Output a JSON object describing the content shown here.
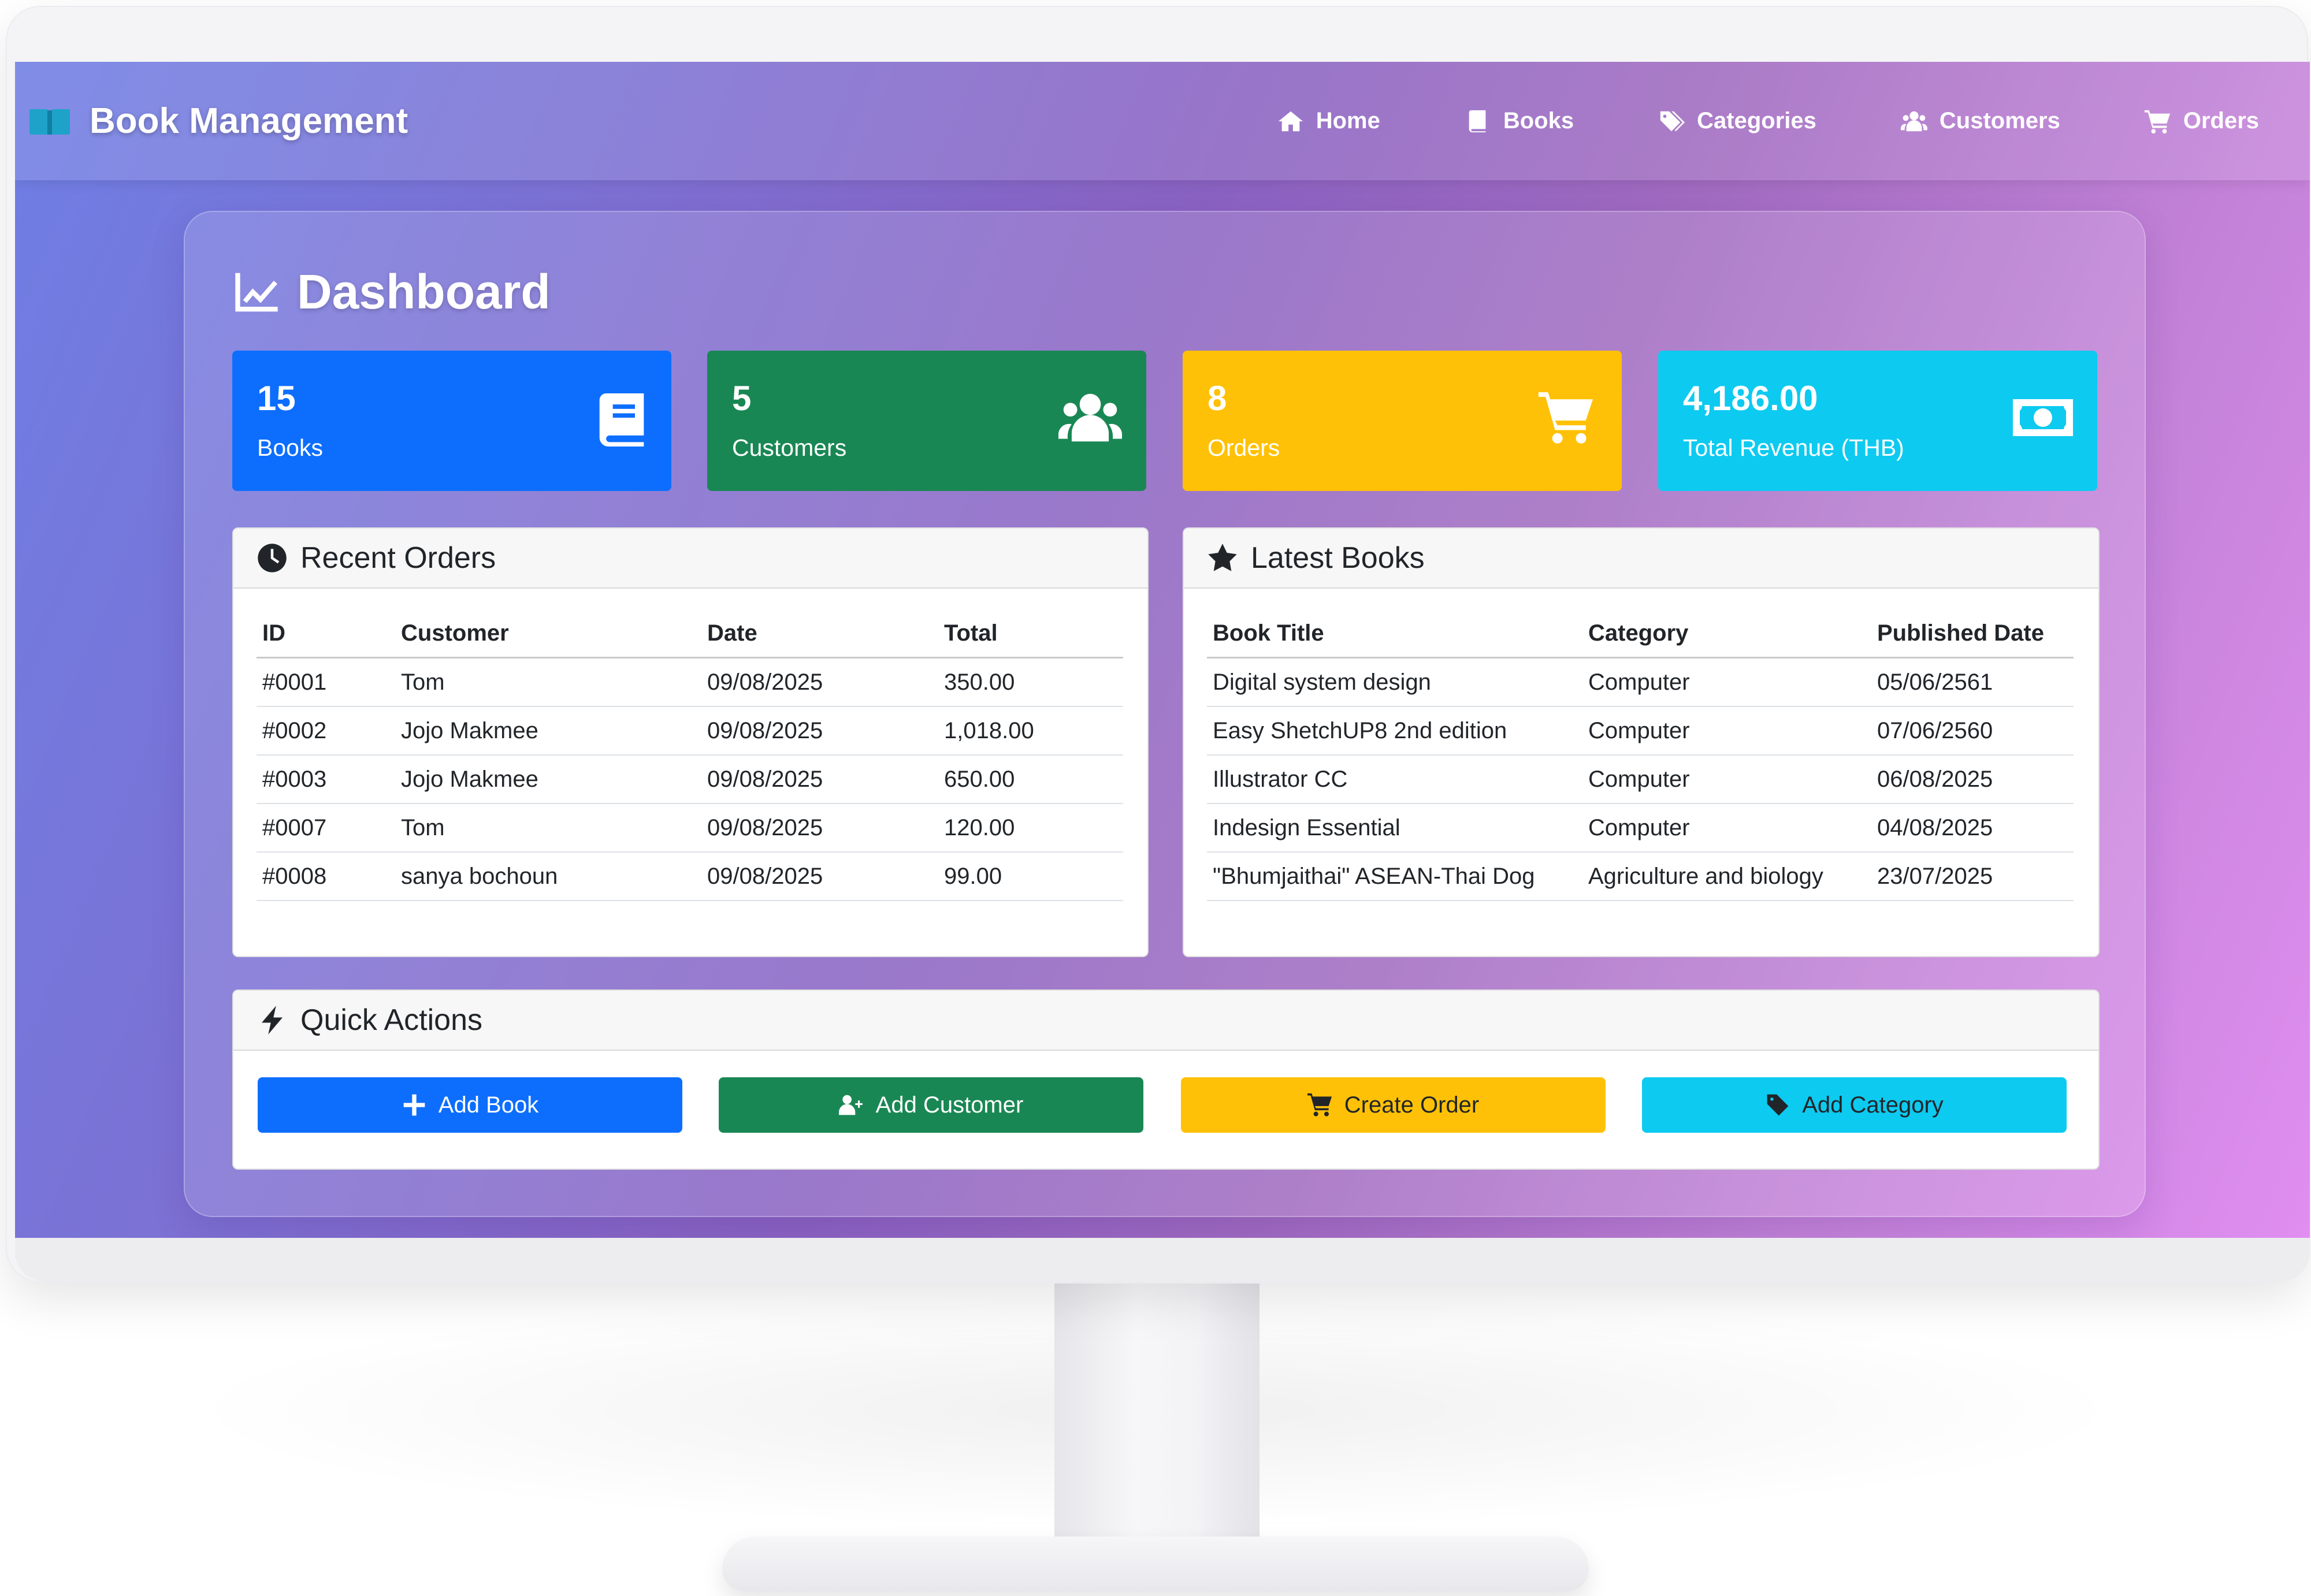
{
  "navbar": {
    "brand": "Book Management",
    "links": [
      {
        "label": "Home",
        "icon": "home-icon"
      },
      {
        "label": "Books",
        "icon": "book-icon"
      },
      {
        "label": "Categories",
        "icon": "tags-icon"
      },
      {
        "label": "Customers",
        "icon": "users-icon"
      },
      {
        "label": "Orders",
        "icon": "cart-icon"
      }
    ]
  },
  "dashboard": {
    "title": "Dashboard",
    "stats": [
      {
        "value": "15",
        "label": "Books",
        "color": "#0d6efd",
        "icon": "book-icon"
      },
      {
        "value": "5",
        "label": "Customers",
        "color": "#198754",
        "icon": "users-icon"
      },
      {
        "value": "8",
        "label": "Orders",
        "color": "#ffc107",
        "icon": "cart-icon"
      },
      {
        "value": "4,186.00",
        "label": "Total Revenue (THB)",
        "color": "#0dcaf0",
        "icon": "money-bill-icon"
      }
    ]
  },
  "recent_orders": {
    "title": "Recent Orders",
    "columns": [
      "ID",
      "Customer",
      "Date",
      "Total"
    ],
    "rows": [
      [
        "#0001",
        "Tom",
        "09/08/2025",
        "350.00"
      ],
      [
        "#0002",
        "Jojo Makmee",
        "09/08/2025",
        "1,018.00"
      ],
      [
        "#0003",
        "Jojo Makmee",
        "09/08/2025",
        "650.00"
      ],
      [
        "#0007",
        "Tom",
        "09/08/2025",
        "120.00"
      ],
      [
        "#0008",
        "sanya bochoun",
        "09/08/2025",
        "99.00"
      ]
    ]
  },
  "latest_books": {
    "title": "Latest Books",
    "columns": [
      "Book Title",
      "Category",
      "Published Date"
    ],
    "rows": [
      [
        "Digital system design",
        "Computer",
        "05/06/2561"
      ],
      [
        "Easy ShetchUP8 2nd edition",
        "Computer",
        "07/06/2560"
      ],
      [
        "Illustrator CC",
        "Computer",
        "06/08/2025"
      ],
      [
        "Indesign Essential",
        "Computer",
        "04/08/2025"
      ],
      [
        "\"Bhumjaithai\" ASEAN-Thai Dog",
        "Agriculture and biology",
        "23/07/2025"
      ]
    ]
  },
  "quick_actions": {
    "title": "Quick Actions",
    "buttons": [
      {
        "label": "Add Book",
        "color": "#0d6efd",
        "icon": "plus-icon"
      },
      {
        "label": "Add Customer",
        "color": "#198754",
        "icon": "user-plus-icon"
      },
      {
        "label": "Create Order",
        "color": "#ffc107",
        "icon": "cart-icon"
      },
      {
        "label": "Add Category",
        "color": "#0dcaf0",
        "icon": "tag-icon"
      }
    ]
  }
}
